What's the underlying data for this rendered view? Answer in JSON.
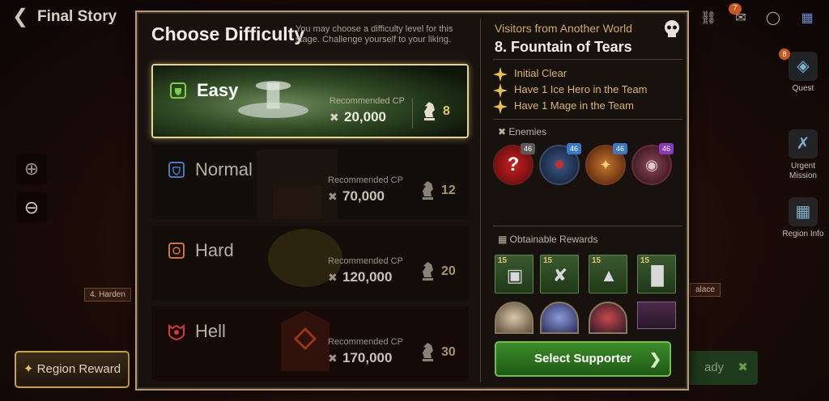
{
  "header": {
    "title": "Final Story",
    "back_icon": "back-arrow-icon",
    "icons": [
      "friends-icon",
      "mail-icon",
      "chat-icon",
      "grid-menu-icon"
    ],
    "mail_badge": "7"
  },
  "map": {
    "labels": [
      "4. Harden",
      "alace"
    ],
    "region_reward": "Region Reward",
    "ready_partial": "ady"
  },
  "side_nav": [
    {
      "label": "Quest",
      "icon": "quest-icon",
      "badge": "8"
    },
    {
      "label": "Urgent Mission",
      "icon": "urgent-mission-icon"
    },
    {
      "label": "Region Info",
      "icon": "region-info-icon"
    }
  ],
  "zoom": {
    "in_icon": "zoom-in-icon",
    "out_icon": "zoom-out-icon"
  },
  "modal": {
    "title": "Choose Difficulty",
    "description": "You may choose a difficulty level for this stage. Challenge yourself to your liking.",
    "difficulties": [
      {
        "name": "Easy",
        "cp_label": "Recommended CP",
        "cp": "20,000",
        "level": "8",
        "selected": true,
        "color": "#6fbf3c"
      },
      {
        "name": "Normal",
        "cp_label": "Recommended CP",
        "cp": "70,000",
        "level": "12",
        "selected": false,
        "color": "#4a78b8"
      },
      {
        "name": "Hard",
        "cp_label": "Recommended CP",
        "cp": "120,000",
        "level": "20",
        "selected": false,
        "color": "#d0723a"
      },
      {
        "name": "Hell",
        "cp_label": "Recommended CP",
        "cp": "170,000",
        "level": "30",
        "selected": false,
        "color": "#d03a3a"
      }
    ]
  },
  "stage_info": {
    "subtitle": "Visitors from Another World",
    "title": "8. Fountain of Tears",
    "conditions": [
      "Initial Clear",
      "Have 1 Ice Hero in the Team",
      "Have 1 Mage in the Team"
    ],
    "enemies_label": "Enemies",
    "enemies": [
      {
        "level": "46",
        "icon": "unknown-enemy-icon",
        "tag_color": "#5a5a5a"
      },
      {
        "level": "46",
        "icon": "dark-beast-enemy-icon",
        "tag_color": "#3a78c8"
      },
      {
        "level": "46",
        "icon": "lion-warrior-enemy-icon",
        "tag_color": "#3a78c8"
      },
      {
        "level": "46",
        "icon": "masked-enemy-icon",
        "tag_color": "#8a3ab8"
      }
    ],
    "rewards_label": "Obtainable Rewards",
    "rewards": [
      {
        "level": "15",
        "icon": "armor-icon"
      },
      {
        "level": "15",
        "icon": "polearm-icon"
      },
      {
        "level": "15",
        "icon": "helmet-icon"
      },
      {
        "level": "15",
        "icon": "boots-icon"
      }
    ],
    "hero_rewards": [
      "hero-portrait-1",
      "hero-portrait-2",
      "hero-portrait-3",
      "item-artifact"
    ],
    "select_button": "Select Supporter"
  }
}
